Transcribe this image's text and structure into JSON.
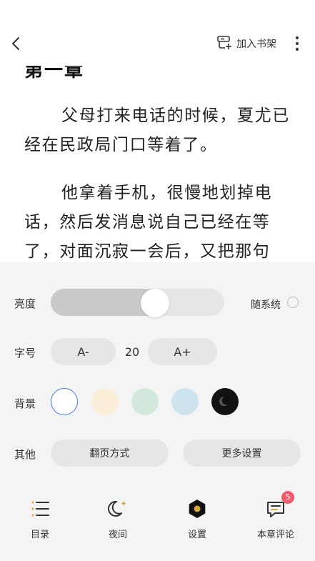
{
  "topbar": {
    "add_to_shelf": "加入书架"
  },
  "reader": {
    "chapter_title": "第一章",
    "paragraphs": [
      "父母打来电话的时候，夏尤已经在民政局门口等着了。",
      "他拿着手机，很慢地划掉电话，然后发消息说自己已经在等了，对面沉寂一会后，又把那句"
    ]
  },
  "settings": {
    "brightness": {
      "label": "亮度",
      "level": 0.6,
      "follow_system_label": "随系统",
      "follow_system": false
    },
    "font": {
      "label": "字号",
      "decrease": "A-",
      "increase": "A+",
      "size": "20"
    },
    "background": {
      "label": "背景",
      "selected": "white",
      "colors": {
        "white": "#ffffff",
        "cream": "#fbeed9",
        "green": "#d2e8da",
        "blue": "#cde4ee",
        "dark": "#111111"
      }
    },
    "other": {
      "label": "其他",
      "page_turn": "翻页方式",
      "more_settings": "更多设置"
    }
  },
  "nav": {
    "items": [
      {
        "label": "目录",
        "icon": "list-icon"
      },
      {
        "label": "夜间",
        "icon": "moon-icon"
      },
      {
        "label": "设置",
        "icon": "settings-icon"
      },
      {
        "label": "本章评论",
        "icon": "comment-icon",
        "badge": "5"
      }
    ]
  },
  "colors": {
    "accent": "#3d77e8",
    "badge": "#f45b6c",
    "icon_gold": "#d6a641"
  }
}
